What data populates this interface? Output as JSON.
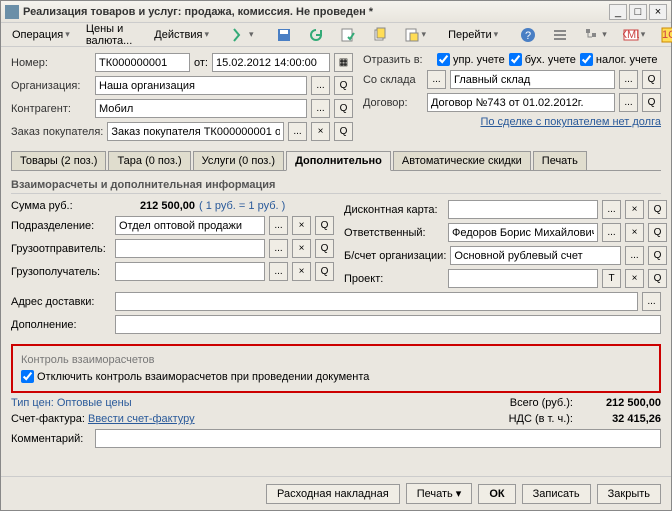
{
  "title": "Реализация товаров и услуг: продажа, комиссия. Не проведен *",
  "toolbar": {
    "operation": "Операция",
    "prices": "Цены и валюта...",
    "actions": "Действия",
    "goto": "Перейти"
  },
  "header": {
    "number_lbl": "Номер:",
    "number": "ТК000000001",
    "from_lbl": "от:",
    "date": "15.02.2012 14:00:00",
    "reflect_lbl": "Отразить в:",
    "chk_mgmt": "упр. учете",
    "chk_acc": "бух. учете",
    "chk_tax": "налог. учете",
    "org_lbl": "Организация:",
    "org": "Наша организация",
    "wh_lbl": "Со склада",
    "wh": "Главный склад",
    "contr_lbl": "Контрагент:",
    "contr": "Мобил",
    "contract_lbl": "Договор:",
    "contract": "Договор №743 от 01.02.2012г.",
    "order_lbl": "Заказ покупателя:",
    "order": "Заказ покупателя ТК000000001 о",
    "debt_link": "По сделке с покупателем нет долга"
  },
  "tabs": [
    "Товары (2 поз.)",
    "Тара (0 поз.)",
    "Услуги (0 поз.)",
    "Дополнительно",
    "Автоматические скидки",
    "Печать"
  ],
  "extra": {
    "subtitle": "Взаиморасчеты и дополнительная информация",
    "sum_lbl": "Сумма руб.:",
    "sum": "212 500,00",
    "rate": "( 1 руб. = 1 руб. )",
    "disc_lbl": "Дисконтная карта:",
    "dept_lbl": "Подразделение:",
    "dept": "Отдел оптовой продажи",
    "resp_lbl": "Ответственный:",
    "resp": "Федоров Борис Михайлович",
    "shipper_lbl": "Грузоотправитель:",
    "bankacc_lbl": "Б/счет организации:",
    "bankacc": "Основной рублевый счет",
    "consignee_lbl": "Грузополучатель:",
    "project_lbl": "Проект:",
    "addr_lbl": "Адрес доставки:",
    "note_lbl": "Дополнение:"
  },
  "control": {
    "title": "Контроль взаиморасчетов",
    "chk": "Отключить контроль взаиморасчетов при проведении документа"
  },
  "footer": {
    "pricetype": "Тип цен: Оптовые цены",
    "total_lbl": "Всего (руб.):",
    "total": "212 500,00",
    "invoice_lbl": "Счет-фактура:",
    "invoice_link": "Ввести счет-фактуру",
    "vat_lbl": "НДС (в т. ч.):",
    "vat": "32 415,26",
    "comment_lbl": "Комментарий:",
    "btn_waybill": "Расходная накладная",
    "btn_print": "Печать",
    "btn_ok": "ОК",
    "btn_save": "Записать",
    "btn_close": "Закрыть"
  }
}
